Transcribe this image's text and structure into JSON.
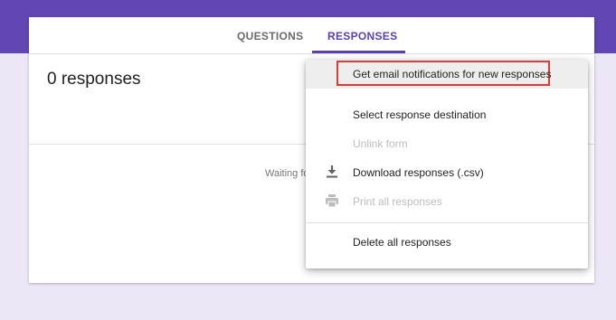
{
  "tabs": {
    "questions": "QUESTIONS",
    "responses": "RESPONSES"
  },
  "responses": {
    "count_label": "0 responses",
    "waiting_text": "Waiting fo"
  },
  "menu": {
    "items": [
      {
        "label": "Get email notifications for new responses",
        "enabled": true,
        "highlighted": true
      },
      {
        "label": "Select response destination",
        "enabled": true
      },
      {
        "label": "Unlink form",
        "enabled": false
      },
      {
        "label": "Download responses (.csv)",
        "enabled": true,
        "icon": "download-icon"
      },
      {
        "label": "Print all responses",
        "enabled": false,
        "icon": "print-icon"
      },
      {
        "label": "Delete all responses",
        "enabled": true
      }
    ]
  },
  "colors": {
    "brand": "#6246b4",
    "accent": "#5b3fb3",
    "highlight_border": "#e53935",
    "background": "#ece7f6"
  }
}
